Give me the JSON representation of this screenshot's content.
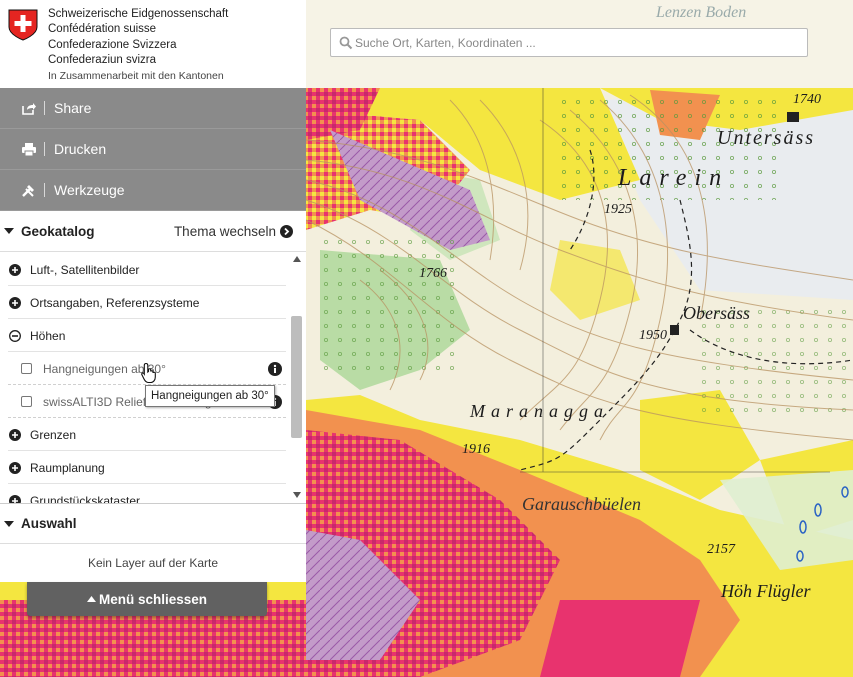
{
  "header": {
    "confederation_names": [
      "Schweizerische Eidgenossenschaft",
      "Confédération suisse",
      "Confederazione Svizzera",
      "Confederaziun svizra"
    ],
    "subtitle": "In Zusammenarbeit mit den Kantonen",
    "search_placeholder": "Suche Ort, Karten, Koordinaten ..."
  },
  "menu": {
    "share_label": "Share",
    "print_label": "Drucken",
    "tools_label": "Werkzeuge"
  },
  "geocatalog": {
    "title": "Geokatalog",
    "change_theme": "Thema wechseln",
    "items": [
      {
        "label": "Luft-, Satellitenbilder",
        "state": "collapsed"
      },
      {
        "label": "Ortsangaben, Referenzsysteme",
        "state": "collapsed"
      },
      {
        "label": "Höhen",
        "state": "expanded"
      },
      {
        "label": "Grenzen",
        "state": "collapsed"
      },
      {
        "label": "Raumplanung",
        "state": "collapsed"
      },
      {
        "label": "Grundstückskataster",
        "state": "collapsed"
      }
    ],
    "layers": [
      {
        "label": "Hangneigungen ab 30°",
        "checked": false
      },
      {
        "label": "swissALTI3D Reliefschattierung",
        "checked": false
      }
    ],
    "tooltip": "Hangneigungen ab 30°"
  },
  "selection": {
    "title": "Auswahl",
    "empty_text": "Kein Layer auf der Karte"
  },
  "close_menu_label": "Menü schliessen",
  "map": {
    "labels": {
      "lenzen_boden": "Lenzen Boden",
      "elev_1740": "1740",
      "untersass": "Untersäss",
      "larein": "Larein",
      "elev_1925": "1925",
      "elev_1766": "1766",
      "obersass": "Obersäss",
      "elev_1950": "1950",
      "maranagga": "Maranagga",
      "elev_1916": "1916",
      "garausch": "Garauschbüelen",
      "elev_2157": "2157",
      "hoh_flugler": "Höh Flügler"
    }
  },
  "colors": {
    "menu_gray": "#8a8a8a",
    "close_button": "#616161",
    "slope_orange": "#f2914f",
    "slope_yellow": "#f4e640",
    "slope_magenta": "#e0307a"
  }
}
